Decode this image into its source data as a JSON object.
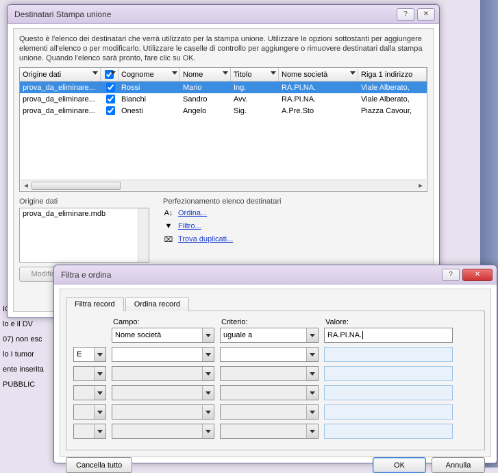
{
  "bg_doc": [
    "ICA",
    "lo e il DV",
    "07) non esc",
    "lo  I tumor",
    "ente inserita",
    "PUBBLIC"
  ],
  "dlg1": {
    "title": "Destinatari Stampa unione",
    "intro": "Questo è l'elenco dei destinatari che verrà utilizzato per la stampa unione. Utilizzare le opzioni sottostanti per aggiungere elementi all'elenco o per modificarlo. Utilizzare le caselle di controllo per aggiungere o rimuovere destinatari dalla stampa unione. Quando l'elenco sarà pronto, fare clic su OK.",
    "columns": {
      "src": "Origine dati",
      "cog": "Cognome",
      "nome": "Nome",
      "tit": "Titolo",
      "soc": "Nome società",
      "ind": "Riga 1 indirizzo"
    },
    "rows": [
      {
        "src": "prova_da_eliminare...",
        "chk": true,
        "cog": "Rossi",
        "nome": "Mario",
        "tit": "Ing.",
        "soc": "RA.PI.NA.",
        "ind": "Viale Alberato,",
        "sel": true
      },
      {
        "src": "prova_da_eliminare...",
        "chk": true,
        "cog": "Bianchi",
        "nome": "Sandro",
        "tit": "Avv.",
        "soc": "RA.PI.NA.",
        "ind": "Viale Alberato,",
        "sel": false
      },
      {
        "src": "prova_da_eliminare...",
        "chk": true,
        "cog": "Onesti",
        "nome": "Angelo",
        "tit": "Sig.",
        "soc": "A.Pre.Sto",
        "ind": "Piazza Cavour,",
        "sel": false
      }
    ],
    "origine_label": "Origine dati",
    "origine_item": "prova_da_eliminare.mdb",
    "perf_label": "Perfezionamento elenco destinatari",
    "link_sort": "Ordina...",
    "link_filter": "Filtro...",
    "link_dup": "Trova duplicati...",
    "modifica": "Modifica"
  },
  "dlg2": {
    "title": "Filtra e ordina",
    "tab_filter": "Filtra record",
    "tab_sort": "Ordina record",
    "hdr_campo": "Campo:",
    "hdr_crit": "Criterio:",
    "hdr_val": "Valore:",
    "rows": [
      {
        "op": "",
        "campo": "Nome società",
        "crit": "uguale a",
        "val": "RA.PI.NA.",
        "active": true
      },
      {
        "op": "E",
        "campo": "",
        "crit": "",
        "val": "",
        "active": true
      },
      {
        "op": "",
        "campo": "",
        "crit": "",
        "val": "",
        "active": false
      },
      {
        "op": "",
        "campo": "",
        "crit": "",
        "val": "",
        "active": false
      },
      {
        "op": "",
        "campo": "",
        "crit": "",
        "val": "",
        "active": false
      },
      {
        "op": "",
        "campo": "",
        "crit": "",
        "val": "",
        "active": false
      }
    ],
    "clear": "Cancella tutto",
    "ok": "OK",
    "cancel": "Annulla"
  }
}
